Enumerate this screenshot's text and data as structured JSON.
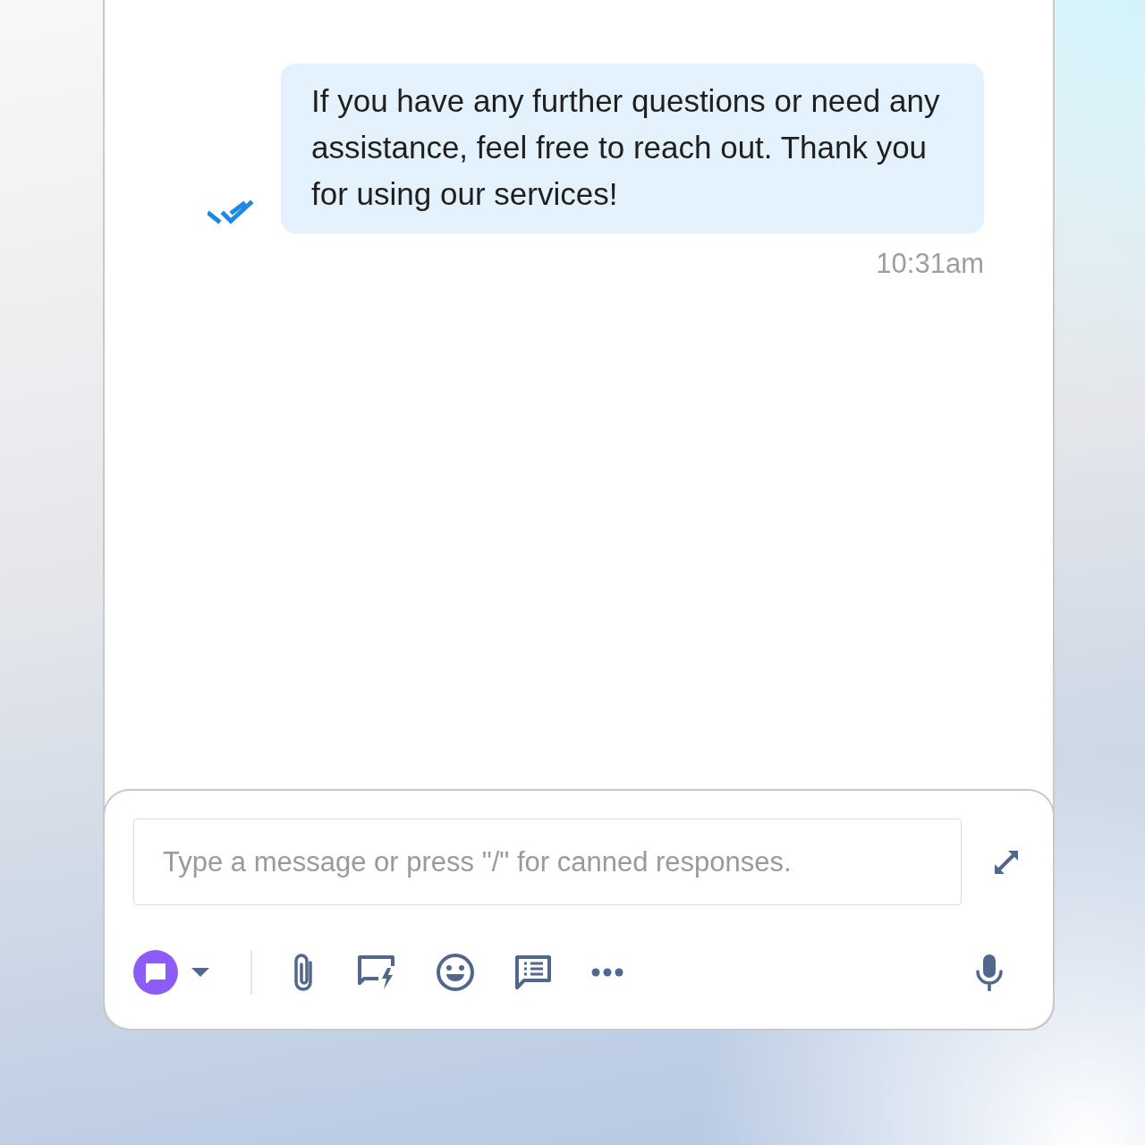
{
  "messages": [
    {
      "text": "If you have any further questions or need any assistance, feel free to reach out. Thank you for using our services!",
      "time": "10:31am",
      "read": true
    }
  ],
  "composer": {
    "placeholder": "Type a message or press \"/\" for canned responses."
  }
}
